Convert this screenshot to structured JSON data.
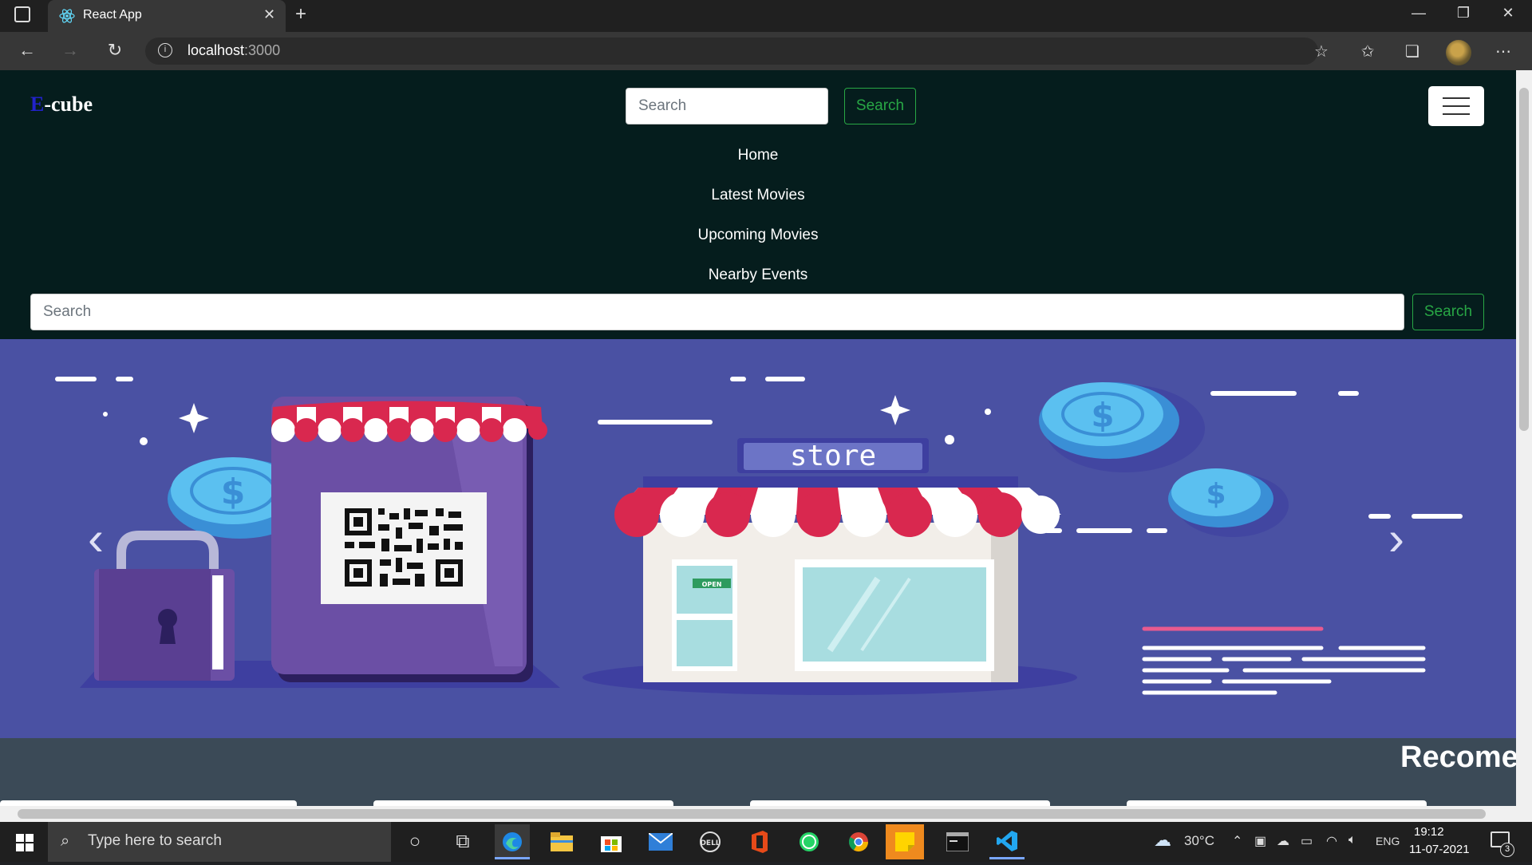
{
  "browser": {
    "tab_title": "React App",
    "tab_close": "✕",
    "new_tab": "+",
    "url_host": "localhost",
    "url_port": ":3000",
    "window_minimize": "—",
    "window_restore": "❐",
    "window_close": "✕"
  },
  "site": {
    "brand_letter": "E",
    "brand_rest": "-cube",
    "search_placeholder": "Search",
    "search_button": "Search",
    "nav_links": [
      "Home",
      "Latest Movies",
      "Upcoming Movies",
      "Nearby Events"
    ],
    "wide_search_placeholder": "Search",
    "wide_search_button": "Search",
    "store_sign": "store",
    "open_sign": "OPEN",
    "carousel_prev": "‹",
    "carousel_next": "›",
    "section_heading": "Recome"
  },
  "taskbar": {
    "search_placeholder": "Type here to search",
    "weather": "30°C",
    "language": "ENG",
    "time": "19:12",
    "date": "11-07-2021",
    "notification_count": "3"
  },
  "colors": {
    "navbar_bg": "#051d1d",
    "carousel_bg": "#4a51a3",
    "accent_green": "#28a745",
    "page_bg": "#3b4a57"
  }
}
